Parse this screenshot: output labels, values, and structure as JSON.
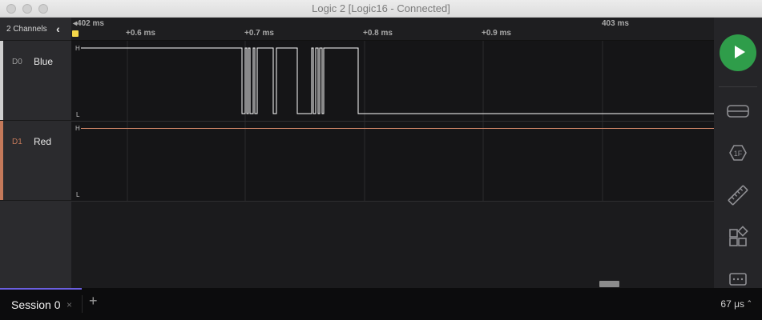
{
  "window": {
    "title": "Logic 2 [Logic16 - Connected]"
  },
  "channels_header": {
    "label": "2 Channels"
  },
  "channels": [
    {
      "id": "D0",
      "name": "Blue",
      "color": "#cfcfcf",
      "id_color": "#9a9a9a",
      "high_label": "H",
      "low_label": "L"
    },
    {
      "id": "D1",
      "name": "Red",
      "color": "#c4795a",
      "id_color": "#c4795a",
      "high_label": "H",
      "low_label": "L"
    }
  ],
  "ruler": {
    "start_label": "402 ms",
    "end_label": "403 ms",
    "ticks": [
      "+0.6 ms",
      "+0.7 ms",
      "+0.8 ms",
      "+0.9 ms"
    ]
  },
  "colors": {
    "accent": "#6b5fe0",
    "play": "#2f9d4a",
    "marker": "#f5d74a",
    "trace_d0": "#ffffff",
    "trace_d1": "#d58a6a"
  },
  "toolbar": {
    "play_icon": "play-icon",
    "icons": [
      "analyzers-icon",
      "measurements-icon",
      "timing-markers-icon",
      "extensions-icon",
      "notes-icon"
    ]
  },
  "sessions": {
    "tabs": [
      {
        "label": "Session 0",
        "close": "×"
      }
    ],
    "add_label": "+"
  },
  "status": {
    "label": "67 μs",
    "chevron": "⌃"
  }
}
